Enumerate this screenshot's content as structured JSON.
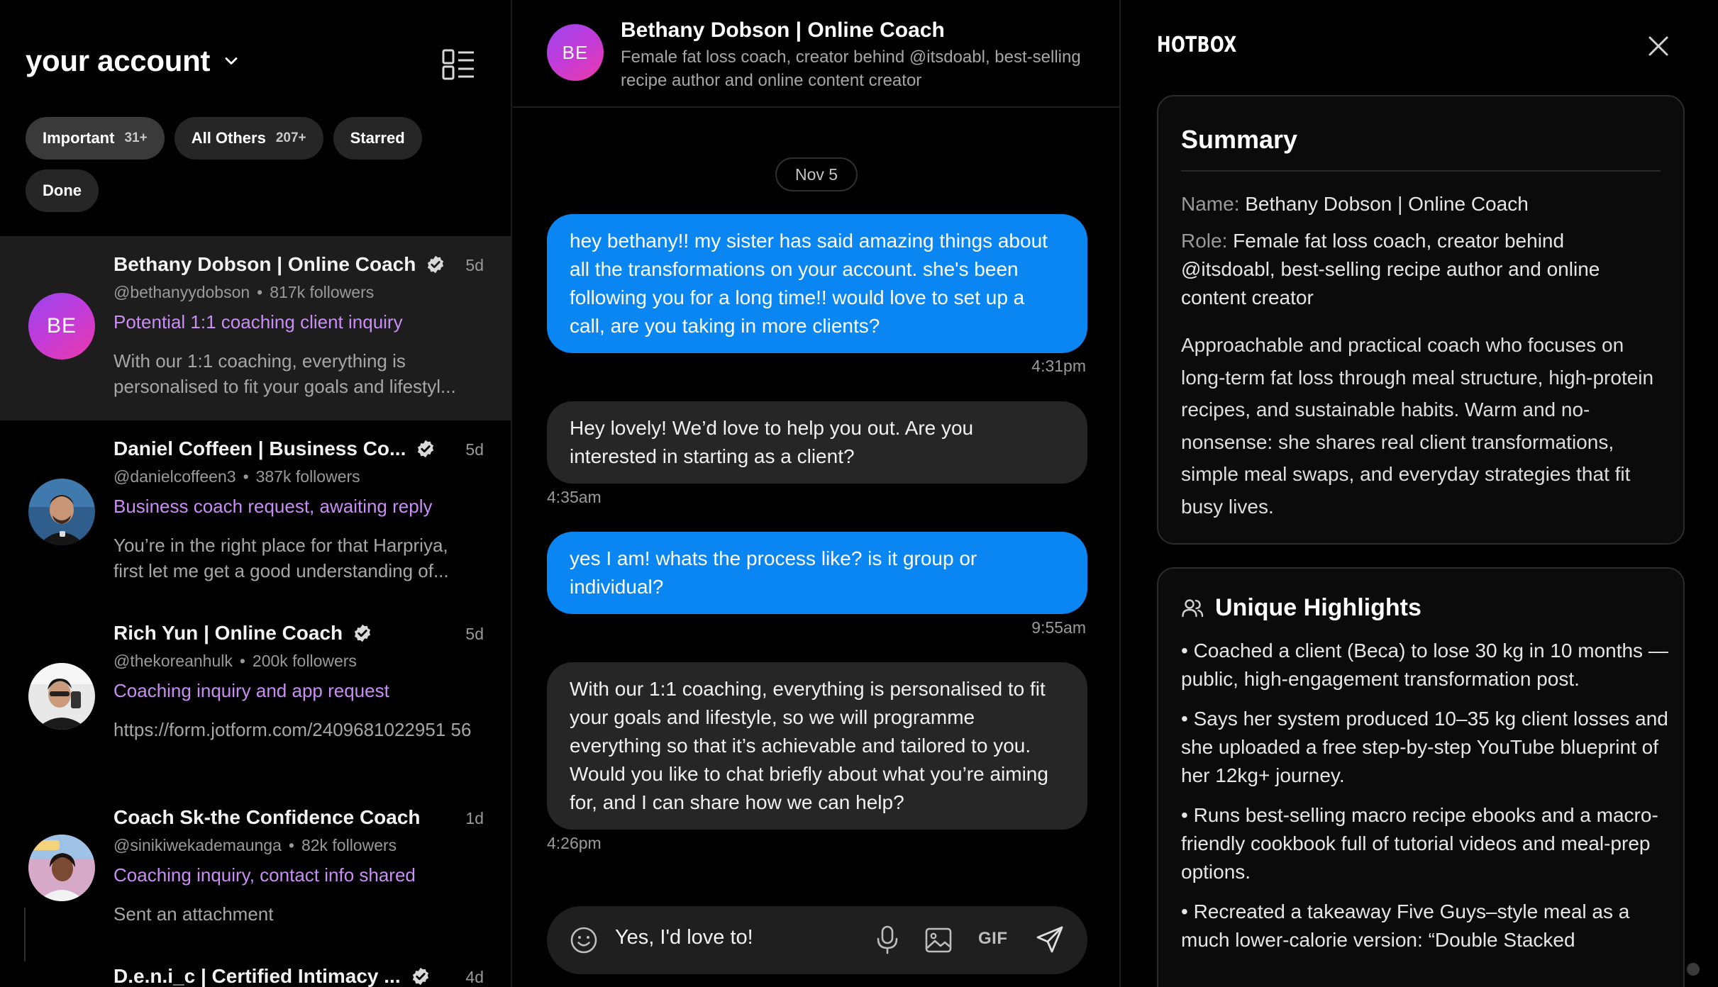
{
  "sidebar": {
    "account_label": "your account",
    "filters": [
      {
        "label": "Important",
        "count": "31+"
      },
      {
        "label": "All Others",
        "count": "207+"
      },
      {
        "label": "Starred",
        "count": ""
      },
      {
        "label": "Done",
        "count": ""
      }
    ],
    "conversations": [
      {
        "initials": "BE",
        "name": "Bethany Dobson | Online Coach",
        "time": "5d",
        "handle": "@bethanyydobson",
        "followers": "817k followers",
        "subject": "Potential 1:1 coaching client inquiry",
        "preview": "With our 1:1 coaching, everything is personalised to fit your goals and lifestyl..."
      },
      {
        "initials": "",
        "name": "Daniel Coffeen | Business Co...",
        "time": "5d",
        "handle": "@danielcoffeen3",
        "followers": "387k followers",
        "subject": "Business coach request, awaiting reply",
        "preview": "You’re in the right place for that Harpriya, first let me get a good understanding of..."
      },
      {
        "initials": "",
        "name": "Rich Yun | Online Coach",
        "time": "5d",
        "handle": "@thekoreanhulk",
        "followers": "200k followers",
        "subject": "Coaching inquiry and app request",
        "preview": "https://form.jotform.com/2409681022951 56"
      },
      {
        "initials": "",
        "name": "Coach Sk-the Confidence Coach",
        "time": "1d",
        "handle": "@sinikiwekademaunga",
        "followers": "82k followers",
        "subject": "Coaching inquiry, contact info shared",
        "preview": "Sent an attachment"
      },
      {
        "initials": "",
        "name": "D.e.n.i_c | Certified Intimacy ...",
        "time": "4d",
        "handle": "",
        "followers": "",
        "subject": "",
        "preview": ""
      }
    ]
  },
  "chat": {
    "header": {
      "initials": "BE",
      "name": "Bethany Dobson | Online Coach",
      "bio": "Female fat loss coach, creator behind @itsdoabl, best-selling recipe author and online content creator"
    },
    "date_pill": "Nov 5",
    "messages": [
      {
        "direction": "out",
        "text": "hey bethany!! my sister has said amazing things about all the transformations on your account. she's been following you for a long time!! would love to set up a call, are you taking in more clients?",
        "time": "4:31pm"
      },
      {
        "direction": "in",
        "text": "Hey lovely! We’d love to help you out. Are you interested in starting as a client?",
        "time": "4:35am"
      },
      {
        "direction": "out",
        "text": "yes I am! whats the process like? is it group or individual?",
        "time": "9:55am"
      },
      {
        "direction": "in",
        "text": "With our 1:1 coaching, everything is personalised to fit your goals and lifestyle, so we will programme everything so that it’s achievable and tailored to you. Would you like to chat briefly about what you’re aiming for, and I can share how we can help?",
        "time": "4:26pm"
      }
    ],
    "composer": {
      "value": "Yes, I'd love to!",
      "gif_label": "GIF"
    }
  },
  "panel": {
    "brand": "HOTBOX",
    "summary": {
      "title": "Summary",
      "name_key": "Name:",
      "name_value": "Bethany Dobson | Online Coach",
      "role_key": "Role:",
      "role_value": "Female fat loss coach, creator behind @itsdoabl, best-selling recipe author and online content creator",
      "description": "Approachable and practical coach who focuses on long-term fat loss through meal structure, high-protein recipes, and sustainable habits. Warm and no-nonsense: she shares real client transformations, simple meal swaps, and everyday strategies that fit busy lives."
    },
    "highlights": {
      "title": "Unique Highlights",
      "items": [
        "• Coached a client (Beca) to lose 30 kg in 10 months — public, high-engagement transformation post.",
        "• Says her system produced 10–35 kg client losses and she uploaded a free step-by-step YouTube blueprint of her 12kg+ journey.",
        "• Runs best-selling macro recipe ebooks and a macro-friendly cookbook full of tutorial videos and meal-prep options.",
        "• Recreated a takeaway Five Guys–style meal as a much lower-calorie version: “Double Stacked"
      ]
    }
  },
  "colors": {
    "accent_blue": "#0a86f2",
    "subject_purple": "#c98ef4",
    "incoming_bubble": "#262626",
    "avatar_gradient_start": "#9b45ee",
    "avatar_gradient_end": "#ec3aa7"
  },
  "icons": [
    "chevron-down-icon",
    "layout-toggle-icon",
    "verified-badge-icon",
    "emoji-icon",
    "microphone-icon",
    "image-icon",
    "send-icon",
    "close-icon",
    "people-icon"
  ]
}
